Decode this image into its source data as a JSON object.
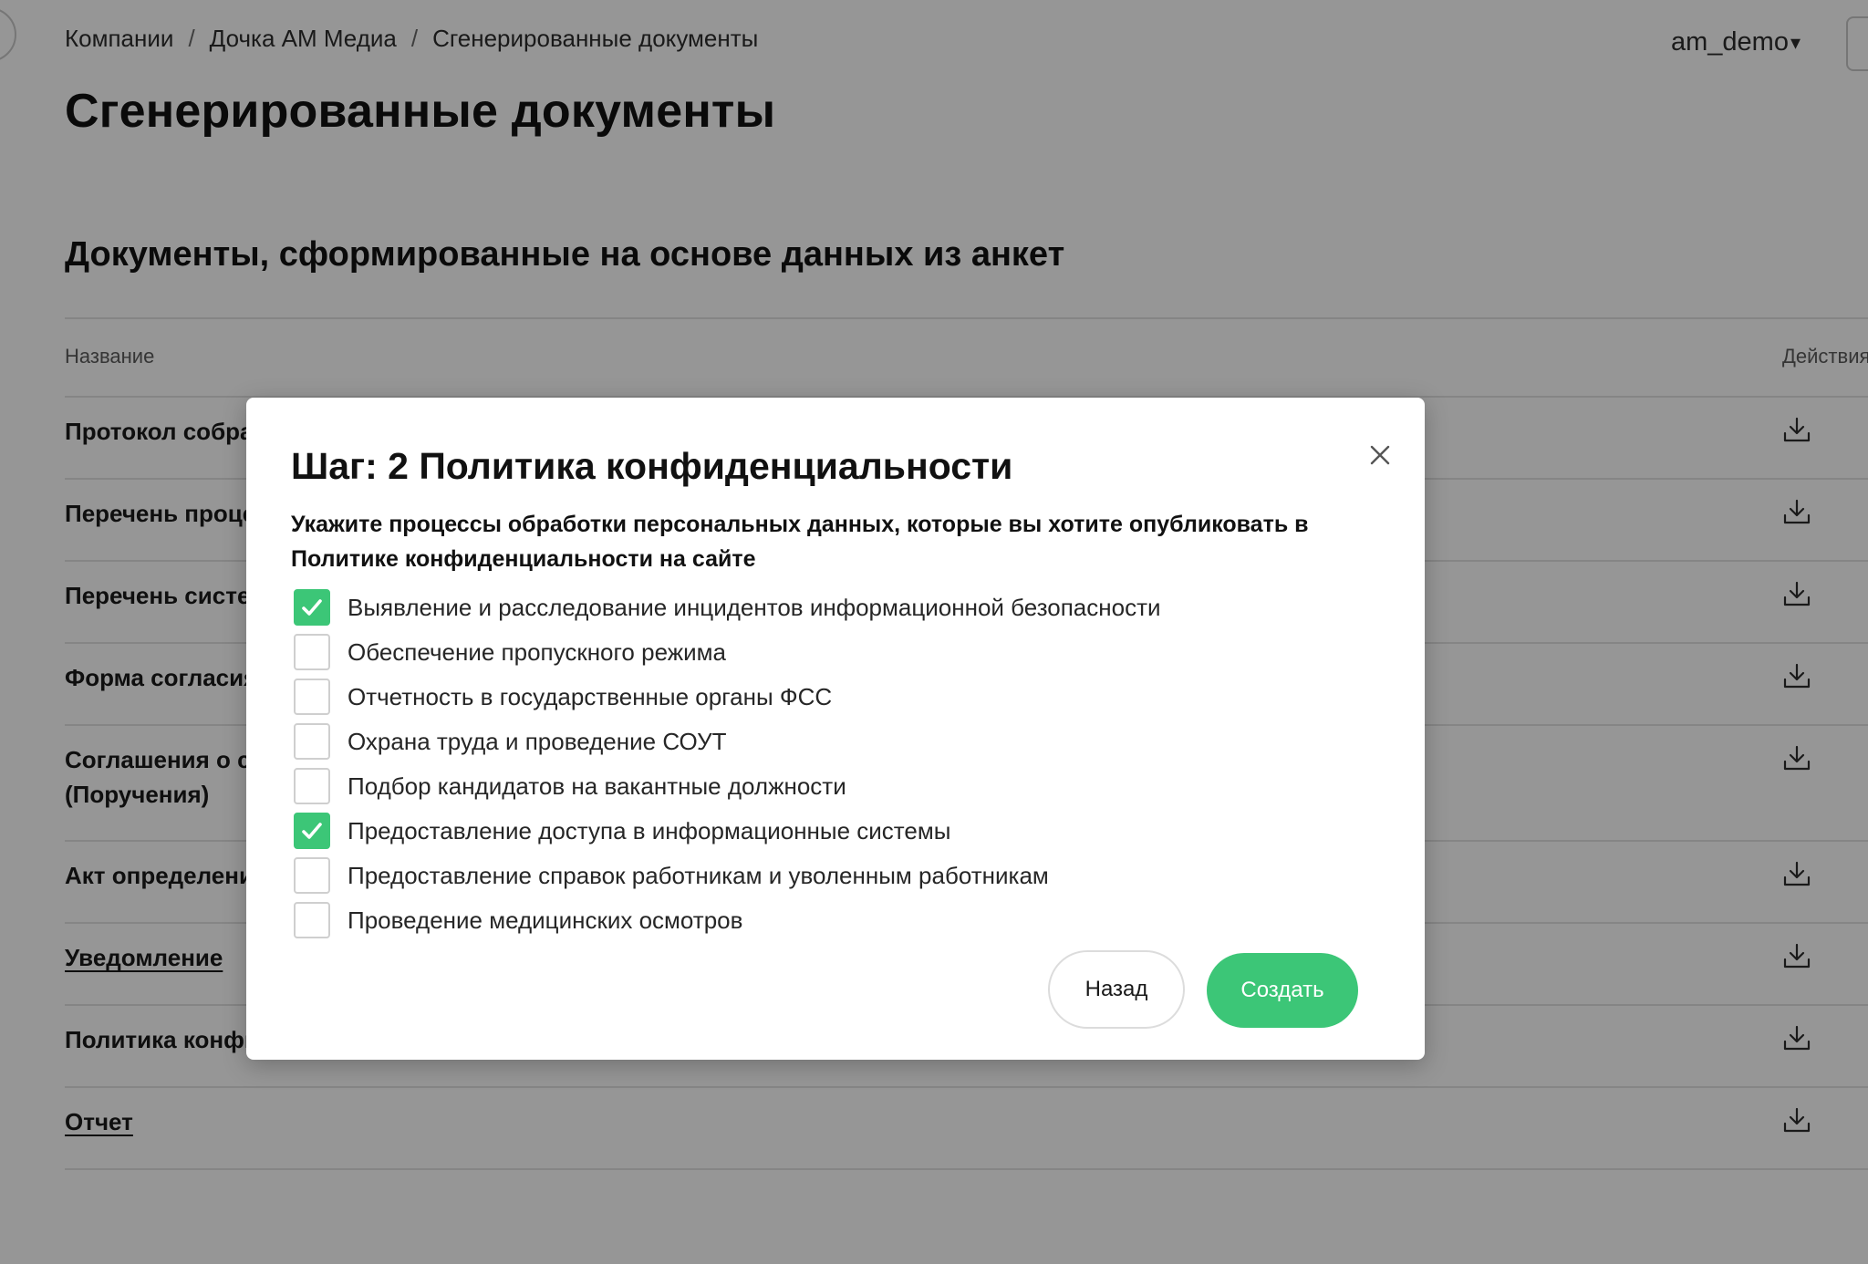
{
  "breadcrumb": {
    "items": [
      "Компании",
      "Дочка АМ Медиа",
      "Сгенерированные документы"
    ],
    "separator": "/"
  },
  "user_menu": {
    "label": "am_demo",
    "caret": "▾"
  },
  "page": {
    "title": "Сгенерированные документы"
  },
  "section": {
    "title": "Документы, сформированные на основе данных из анкет"
  },
  "table": {
    "columns": {
      "name": "Название",
      "actions": "Действия"
    },
    "rows": [
      {
        "title": "Протокол собра"
      },
      {
        "title": "Перечень проце"
      },
      {
        "title": "Перечень систем"
      },
      {
        "title": "Форма согласия"
      },
      {
        "title": "Соглашения о со",
        "title_line2": "(Поручения)"
      },
      {
        "title": "Акт определени"
      },
      {
        "title": "Уведомление"
      },
      {
        "title": "Политика конфи"
      },
      {
        "title": "Отчет"
      }
    ]
  },
  "modal": {
    "title": "Шаг: 2 Политика конфиденциальности",
    "subtitle": "Укажите процессы обработки персональных данных, которые вы хотите опубликовать в Политике конфиденциальности на сайте",
    "options": [
      {
        "label": "Выявление и расследование инцидентов информационной безопасности",
        "checked": true
      },
      {
        "label": "Обеспечение пропускного режима",
        "checked": false
      },
      {
        "label": "Отчетность в государственные органы ФСС",
        "checked": false
      },
      {
        "label": "Охрана труда и проведение СОУТ",
        "checked": false
      },
      {
        "label": "Подбор кандидатов на вакантные должности",
        "checked": false
      },
      {
        "label": "Предоставление доступа в информационные системы",
        "checked": true
      },
      {
        "label": "Предоставление справок работникам и уволенным работникам",
        "checked": false
      },
      {
        "label": "Проведение медицинских осмотров",
        "checked": false
      }
    ],
    "back_label": "Назад",
    "create_label": "Создать"
  },
  "colors": {
    "accent": "#3cc677",
    "overlay": "rgba(0,0,0,0.41)",
    "border": "#cfcfcf"
  },
  "icons": {
    "row_action": "download-icon",
    "close": "close-icon",
    "checked": "checkmark-icon"
  }
}
